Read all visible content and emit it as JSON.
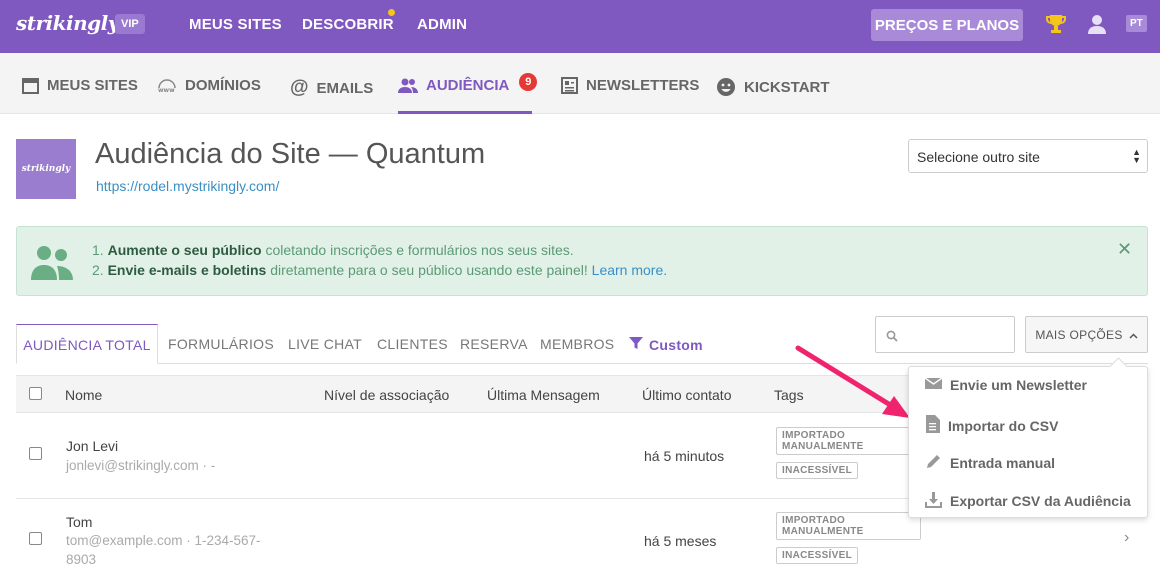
{
  "topbar": {
    "logo": "strikingly",
    "vip_badge": "VIP",
    "nav": [
      "MEUS SITES",
      "DESCOBRIR",
      "ADMIN"
    ],
    "plans_button": "PREÇOS E PLANOS",
    "language": "PT",
    "icons": [
      "trophy-icon",
      "user-icon"
    ],
    "colors": {
      "brand": "#7f58c0",
      "notification_dot": "#f5c518"
    }
  },
  "subnav": {
    "items": [
      {
        "label": "MEUS SITES",
        "icon": "calendar-icon"
      },
      {
        "label": "DOMÍNIOS",
        "icon": "www-icon"
      },
      {
        "label": "EMAILS",
        "icon": "at-icon"
      },
      {
        "label": "AUDIÊNCIA",
        "icon": "users-icon",
        "badge": "9",
        "active": true
      },
      {
        "label": "NEWSLETTERS",
        "icon": "newsletter-icon"
      },
      {
        "label": "KICKSTART",
        "icon": "smile-icon"
      }
    ]
  },
  "header": {
    "thumbnail_text": "strikingly",
    "title": "Audiência do Site — Quantum",
    "url": "https://rodel.mystrikingly.com/",
    "site_select": "Selecione outro site"
  },
  "info": {
    "line1_num": "1.",
    "line1_bold": "Aumente o seu público",
    "line1_rest": "coletando inscrições e formulários nos seus sites.",
    "line2_num": "2.",
    "line2_bold": "Envie e-mails e boletins",
    "line2_rest": "diretamente para o seu público usando este painel!",
    "line2_link": "Learn more.",
    "close": "✕"
  },
  "tabs": [
    "AUDIÊNCIA TOTAL",
    "FORMULÁRIOS",
    "LIVE CHAT",
    "CLIENTES",
    "RESERVA",
    "MEMBROS",
    "Custom"
  ],
  "toolbar": {
    "more_options": "MAIS OPÇÕES"
  },
  "table": {
    "headers": [
      "Nome",
      "Nível de associação",
      "Última Mensagem",
      "Último contato",
      "Tags"
    ],
    "rows": [
      {
        "name": "Jon Levi",
        "detail1": "jonlevi@strikingly.com · -",
        "detail2": "",
        "last_contact": "há 5 minutos",
        "tags": [
          "IMPORTADO MANUALMENTE",
          "INACESSÍVEL"
        ]
      },
      {
        "name": "Tom",
        "detail1": "tom@example.com · 1-234-567-",
        "detail2": "8903",
        "last_contact": "há 5 meses",
        "tags": [
          "IMPORTADO MANUALMENTE",
          "INACESSÍVEL"
        ]
      }
    ]
  },
  "dropdown": {
    "items": [
      {
        "label": "Envie um Newsletter",
        "icon": "envelope-icon"
      },
      {
        "label": "Importar do CSV",
        "icon": "file-icon"
      },
      {
        "label": "Entrada manual",
        "icon": "pencil-icon"
      },
      {
        "label": "Exportar CSV da Audiência",
        "icon": "download-icon"
      }
    ]
  }
}
